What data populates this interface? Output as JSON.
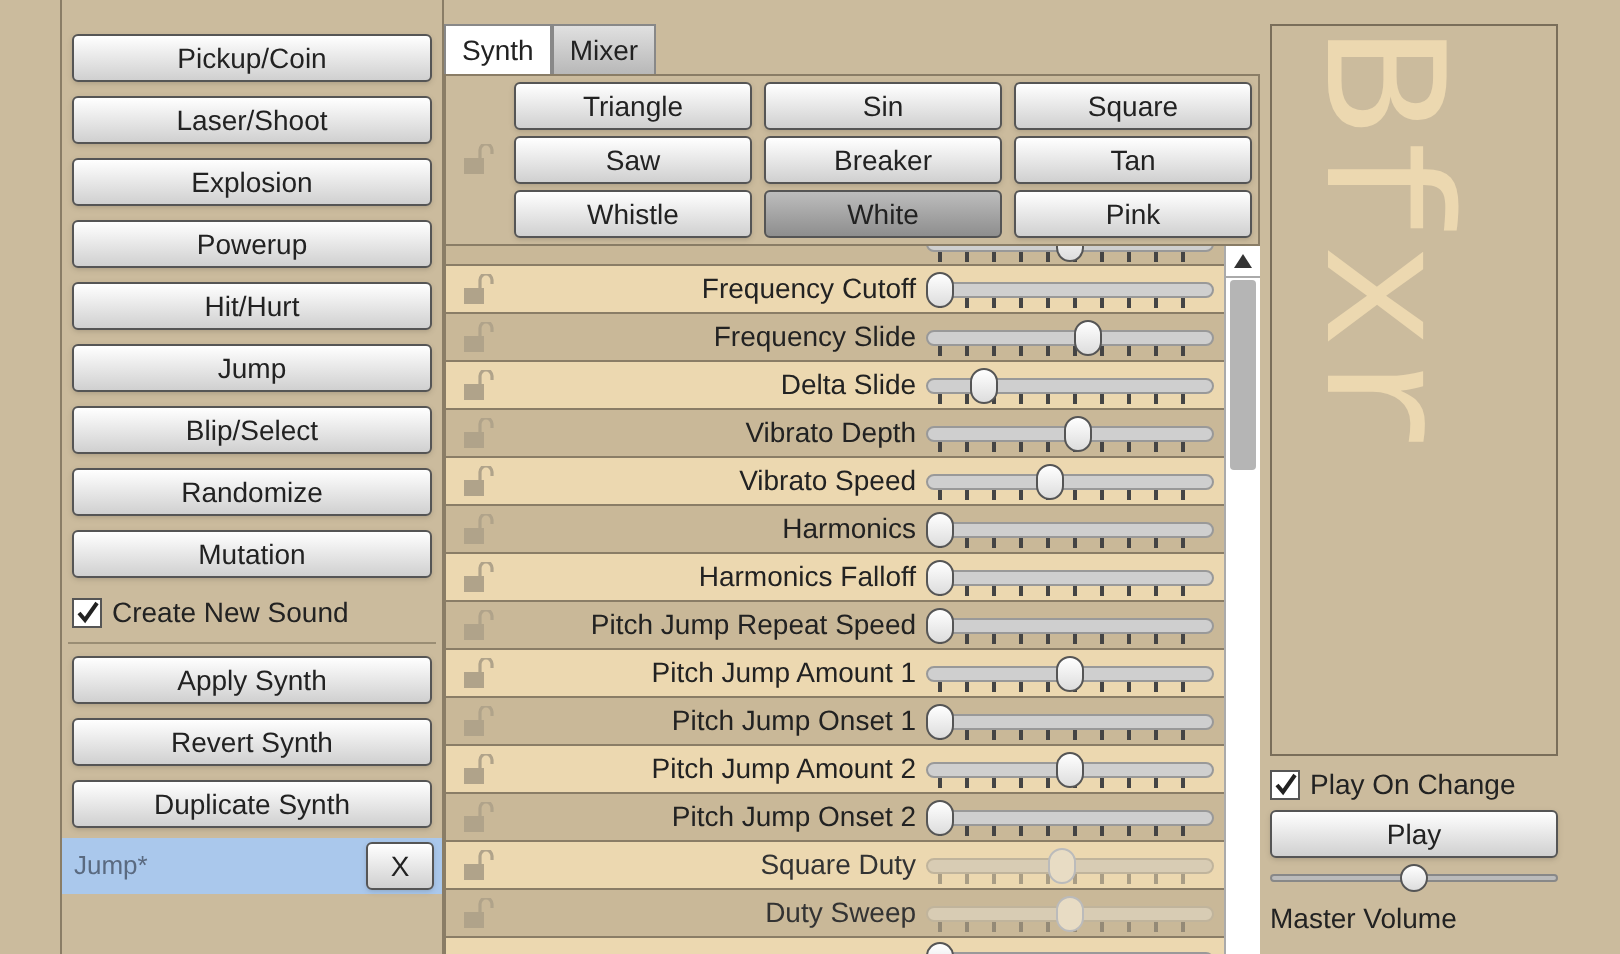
{
  "sidebar": {
    "generators": [
      "Pickup/Coin",
      "Laser/Shoot",
      "Explosion",
      "Powerup",
      "Hit/Hurt",
      "Jump",
      "Blip/Select",
      "Randomize",
      "Mutation"
    ],
    "create_new_sound": {
      "label": "Create New Sound",
      "checked": true
    },
    "synth_buttons": [
      "Apply Synth",
      "Revert Synth",
      "Duplicate Synth"
    ],
    "sounds": [
      {
        "name": "Jump*",
        "selected": true,
        "close": "X"
      }
    ]
  },
  "tabs": [
    {
      "label": "Synth",
      "selected": true
    },
    {
      "label": "Mixer",
      "selected": false
    }
  ],
  "waveforms": [
    {
      "label": "Triangle",
      "selected": false
    },
    {
      "label": "Sin",
      "selected": false
    },
    {
      "label": "Square",
      "selected": false
    },
    {
      "label": "Saw",
      "selected": false
    },
    {
      "label": "Breaker",
      "selected": false
    },
    {
      "label": "Tan",
      "selected": false
    },
    {
      "label": "Whistle",
      "selected": false
    },
    {
      "label": "White",
      "selected": true
    },
    {
      "label": "Pink",
      "selected": false
    }
  ],
  "parameters": [
    {
      "kind": "partial",
      "level": 0.5
    },
    {
      "kind": "slider",
      "label": "Frequency Cutoff",
      "level": 0,
      "disabled": false
    },
    {
      "kind": "slider",
      "label": "Frequency Slide",
      "level": 0.57,
      "disabled": false
    },
    {
      "kind": "slider",
      "label": "Delta Slide",
      "level": 0.17,
      "disabled": false
    },
    {
      "kind": "slider",
      "label": "Vibrato Depth",
      "level": 0.53,
      "disabled": false
    },
    {
      "kind": "slider",
      "label": "Vibrato Speed",
      "level": 0.42,
      "disabled": false
    },
    {
      "kind": "slider",
      "label": "Harmonics",
      "level": 0,
      "disabled": false
    },
    {
      "kind": "slider",
      "label": "Harmonics Falloff",
      "level": 0,
      "disabled": false
    },
    {
      "kind": "slider",
      "label": "Pitch Jump Repeat Speed",
      "level": 0,
      "disabled": false
    },
    {
      "kind": "slider",
      "label": "Pitch Jump Amount 1",
      "level": 0.5,
      "disabled": false
    },
    {
      "kind": "slider",
      "label": "Pitch Jump Onset 1",
      "level": 0,
      "disabled": false
    },
    {
      "kind": "slider",
      "label": "Pitch Jump Amount 2",
      "level": 0.5,
      "disabled": false
    },
    {
      "kind": "slider",
      "label": "Pitch Jump Onset 2",
      "level": 0,
      "disabled": false
    },
    {
      "kind": "slider",
      "label": "Square Duty",
      "level": 0.47,
      "disabled": true
    },
    {
      "kind": "slider",
      "label": "Duty Sweep",
      "level": 0.5,
      "disabled": true
    },
    {
      "kind": "partial",
      "level": 0
    }
  ],
  "logo": "Bfxr",
  "play_on_change": {
    "label": "Play On Change",
    "checked": true
  },
  "play_button": "Play",
  "master_volume": {
    "label": "Master Volume",
    "level": 0.5
  }
}
